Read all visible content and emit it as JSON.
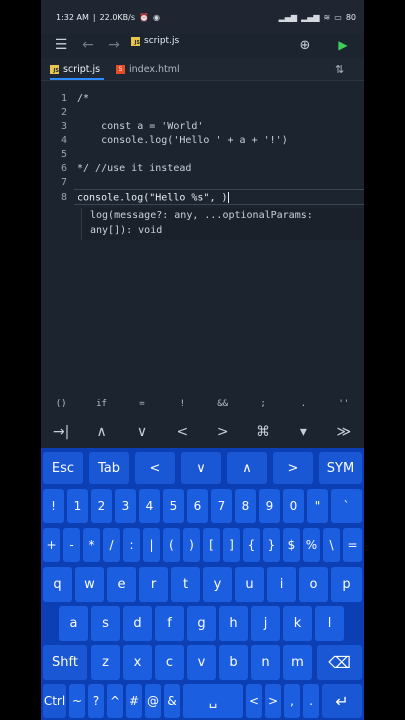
{
  "status_bar": {
    "time": "1:32 AM",
    "network_speed": "22.0KB/s",
    "battery": "80"
  },
  "toolbar": {
    "filename": "script.js"
  },
  "tabs": [
    {
      "label": "script.js",
      "badge": "JS",
      "active": true
    },
    {
      "label": "index.html",
      "badge": "5",
      "active": false
    }
  ],
  "editor": {
    "line_numbers": [
      "1",
      "2",
      "3",
      "4",
      "5",
      "6",
      "7",
      "8"
    ],
    "lines": [
      "/*",
      "",
      "    const a = 'World'",
      "    console.log('Hello ' + a + '!')",
      "",
      "*/ //use it instead",
      "",
      "console.log(\"Hello %s\", )"
    ],
    "hint_line1": "log(message?: any, ...optionalParams:",
    "hint_line2": "any[]): void"
  },
  "symbol_row": [
    "()",
    "if",
    "=",
    "!",
    "&&",
    ";",
    ".",
    "''"
  ],
  "nav_row": [
    "→|",
    "∧",
    "∨",
    "<",
    ">",
    "⌘",
    "▾",
    "≫"
  ],
  "keyboard": {
    "row1": [
      "Esc",
      "Tab",
      "<",
      "∨",
      "∧",
      ">",
      "SYM"
    ],
    "row2": [
      "!",
      "1",
      "2",
      "3",
      "4",
      "5",
      "6",
      "7",
      "8",
      "9",
      "0",
      "\"",
      "`"
    ],
    "row3": [
      "+",
      "-",
      "*",
      "/",
      ":",
      "|",
      "(",
      ")",
      "[",
      "]",
      "{",
      "}",
      "$",
      "%",
      "\\",
      "="
    ],
    "row4": [
      "q",
      "w",
      "e",
      "r",
      "t",
      "y",
      "u",
      "i",
      "o",
      "p"
    ],
    "row5": [
      "a",
      "s",
      "d",
      "f",
      "g",
      "h",
      "j",
      "k",
      "l"
    ],
    "row6": [
      "Shft",
      "z",
      "x",
      "c",
      "v",
      "b",
      "n",
      "m",
      "⌫"
    ],
    "row7": [
      "Ctrl",
      "~",
      "?",
      "^",
      "#",
      "@",
      "&",
      "␣",
      "<",
      ">",
      ",",
      ".",
      "↵"
    ]
  },
  "colors": {
    "editor_bg": "#1c2430",
    "keyboard_bg": "#0b3fb3",
    "key_bg": "#1b5fe0",
    "accent": "#2e8bff",
    "run_green": "#3ccf5a"
  }
}
